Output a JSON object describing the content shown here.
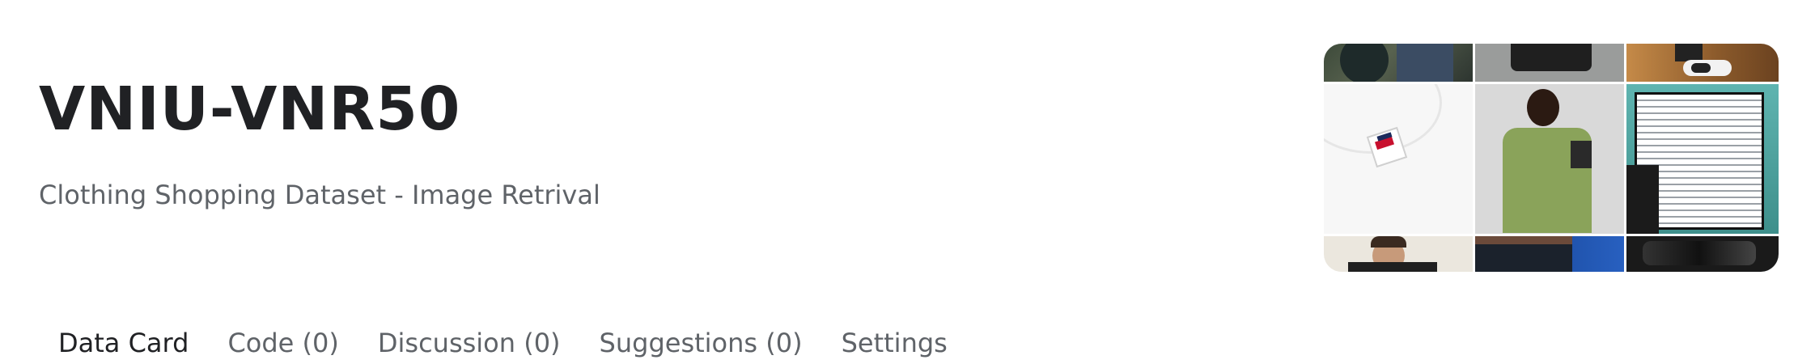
{
  "header": {
    "title": "VNIU-VNR50",
    "subtitle": "Clothing Shopping Dataset - Image Retrival"
  },
  "tabs": [
    {
      "label": "Data Card",
      "active": true
    },
    {
      "label": "Code (0)",
      "active": false
    },
    {
      "label": "Discussion (0)",
      "active": false
    },
    {
      "label": "Suggestions (0)",
      "active": false
    },
    {
      "label": "Settings",
      "active": false
    }
  ],
  "cover_collage": {
    "tiles": [
      "person-jacket",
      "black-garment",
      "sneakers",
      "white-tshirt-label",
      "green-tshirt-model",
      "striped-tshirt-model",
      "man-portrait",
      "shorts-model",
      "black-leather"
    ]
  },
  "colors": {
    "title": "#202124",
    "muted_text": "#5f6368",
    "background": "#ffffff"
  }
}
